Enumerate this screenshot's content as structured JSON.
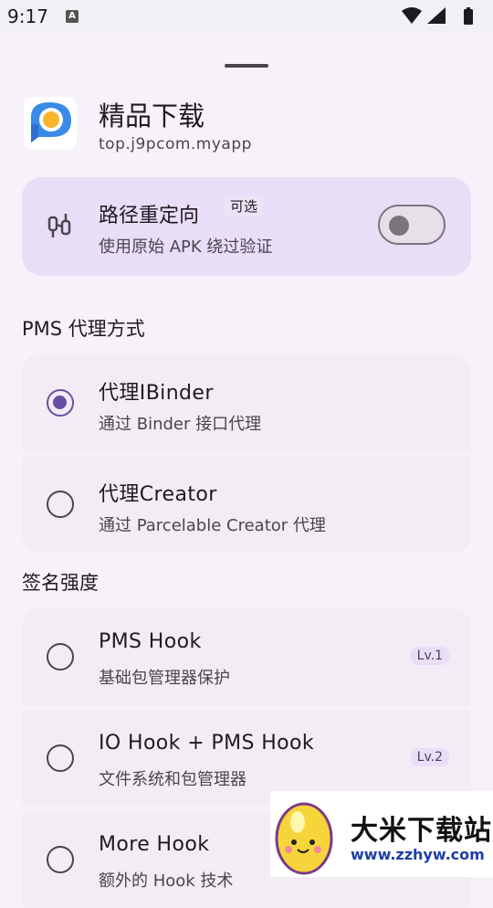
{
  "status_bar": {
    "time": "9:17",
    "notification_glyph": "A",
    "icons": [
      "wifi-icon",
      "signal-icon",
      "battery-icon"
    ]
  },
  "app": {
    "name": "精品下载",
    "package": "top.j9pcom.myapp",
    "icon": "app-logo-icon"
  },
  "redirect": {
    "title": "路径重定向",
    "badge": "可选",
    "subtitle": "使用原始 APK 绕过验证",
    "enabled": false,
    "icon": "route-icon"
  },
  "pms_section": {
    "title": "PMS 代理方式",
    "options": [
      {
        "title": "代理IBinder",
        "subtitle": "通过 Binder 接口代理",
        "selected": true
      },
      {
        "title": "代理Creator",
        "subtitle": "通过 Parcelable Creator 代理",
        "selected": false
      }
    ]
  },
  "signature_section": {
    "title": "签名强度",
    "options": [
      {
        "title": "PMS Hook",
        "subtitle": "基础包管理器保护",
        "level": "Lv.1",
        "selected": false
      },
      {
        "title": "IO Hook + PMS Hook",
        "subtitle": "文件系统和包管理器",
        "level": "Lv.2",
        "selected": false
      },
      {
        "title": "More Hook",
        "subtitle": "额外的 Hook 技术",
        "level": "",
        "selected": false
      }
    ]
  },
  "watermark": {
    "title": "大米下载站",
    "url": "www.zzhyw.com"
  },
  "colors": {
    "accent": "#6750a4",
    "card_highlight": "#e8def8",
    "surface": "#f7f1f9",
    "option_bg": "#f2ecf4"
  }
}
